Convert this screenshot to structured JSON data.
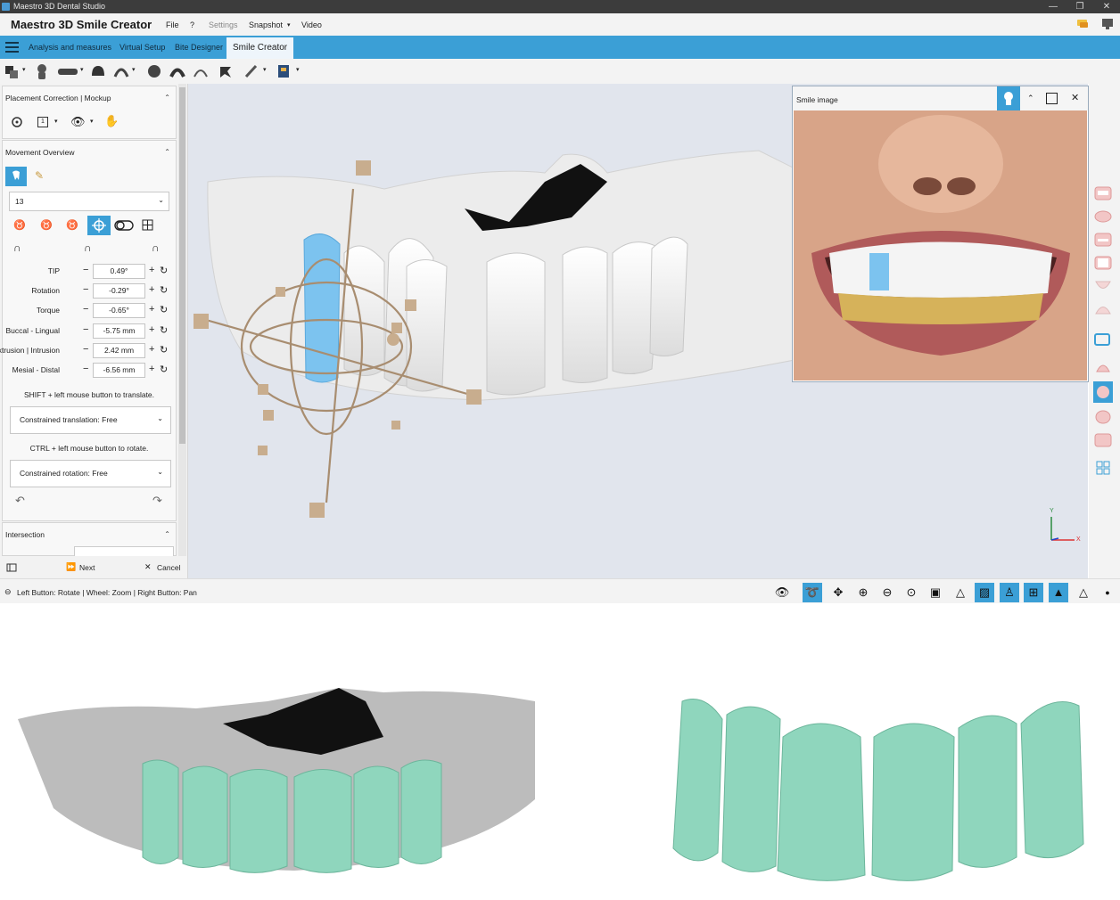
{
  "window": {
    "title": "Maestro 3D Dental Studio",
    "controls": [
      "—",
      "❐",
      "✕"
    ]
  },
  "menubar": {
    "brand": "Maestro 3D Smile Creator",
    "items": [
      "File",
      "?",
      "Settings",
      "Snapshot",
      "Video"
    ]
  },
  "tabs": [
    "Analysis and measures",
    "Virtual Setup",
    "Bite Designer",
    "Smile Creator"
  ],
  "left_panel": {
    "placement_section": {
      "title": "Placement Correction | Mockup",
      "layer_value": "1"
    },
    "movement_section": {
      "title": "Movement Overview",
      "tooth_select": "13",
      "rows": [
        {
          "label": "TIP",
          "value": "0.49°"
        },
        {
          "label": "Rotation",
          "value": "-0.29°"
        },
        {
          "label": "Torque",
          "value": "-0.65°"
        },
        {
          "label": "Buccal - Lingual",
          "value": "-5.75 mm"
        },
        {
          "label": "Extrusion | Intrusion",
          "value": "2.42 mm"
        },
        {
          "label": "Mesial - Distal",
          "value": "-6.56 mm"
        }
      ],
      "minus": "−",
      "plus": "+",
      "translate_hint": "SHIFT + left mouse button to translate.",
      "translation_dropdown": "Constrained translation: Free",
      "rotate_hint": "CTRL + left mouse button to rotate.",
      "rotation_dropdown": "Constrained rotation: Free",
      "undo": "↶",
      "redo": "↷"
    },
    "intersection_section": {
      "title": "Intersection"
    },
    "footer": {
      "next": "Next",
      "cancel": "Cancel",
      "next_icon": "⏩",
      "cancel_icon": "✕"
    }
  },
  "smile_window": {
    "title": "Smile image"
  },
  "axis": {
    "x": "X",
    "y": "Y"
  },
  "status": {
    "text": "Left Button: Rotate | Wheel: Zoom | Right Button: Pan"
  },
  "colors": {
    "accent": "#3b9fd6",
    "selected_tooth": "#7cc3ef",
    "veneer": "#8fd6bd",
    "gizmo": "#c8ad8e"
  }
}
